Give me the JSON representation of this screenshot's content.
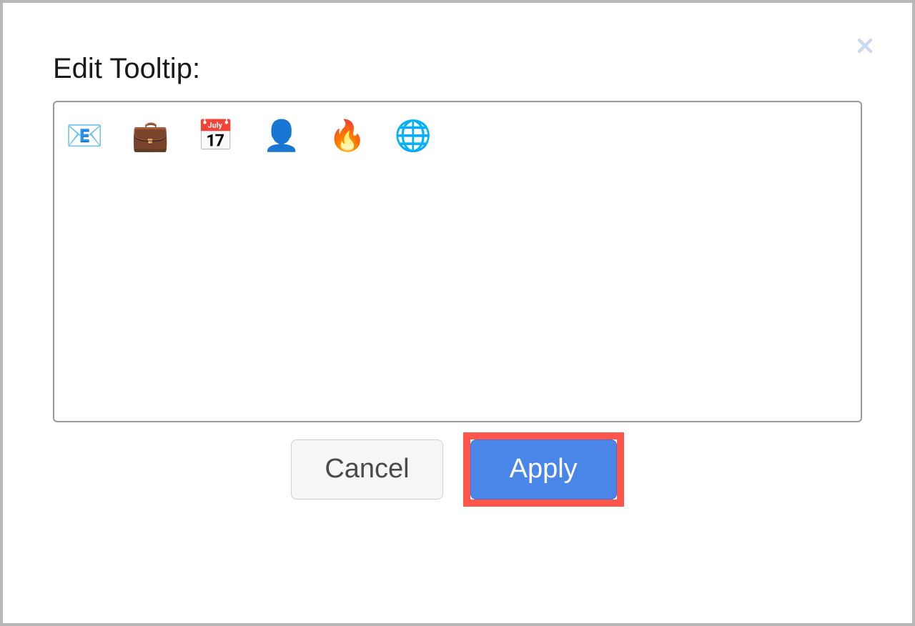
{
  "dialog": {
    "title": "Edit Tooltip:",
    "textarea_value": "📧 💼 📅 👤 🔥 🌐",
    "cancel_label": "Cancel",
    "apply_label": "Apply"
  }
}
